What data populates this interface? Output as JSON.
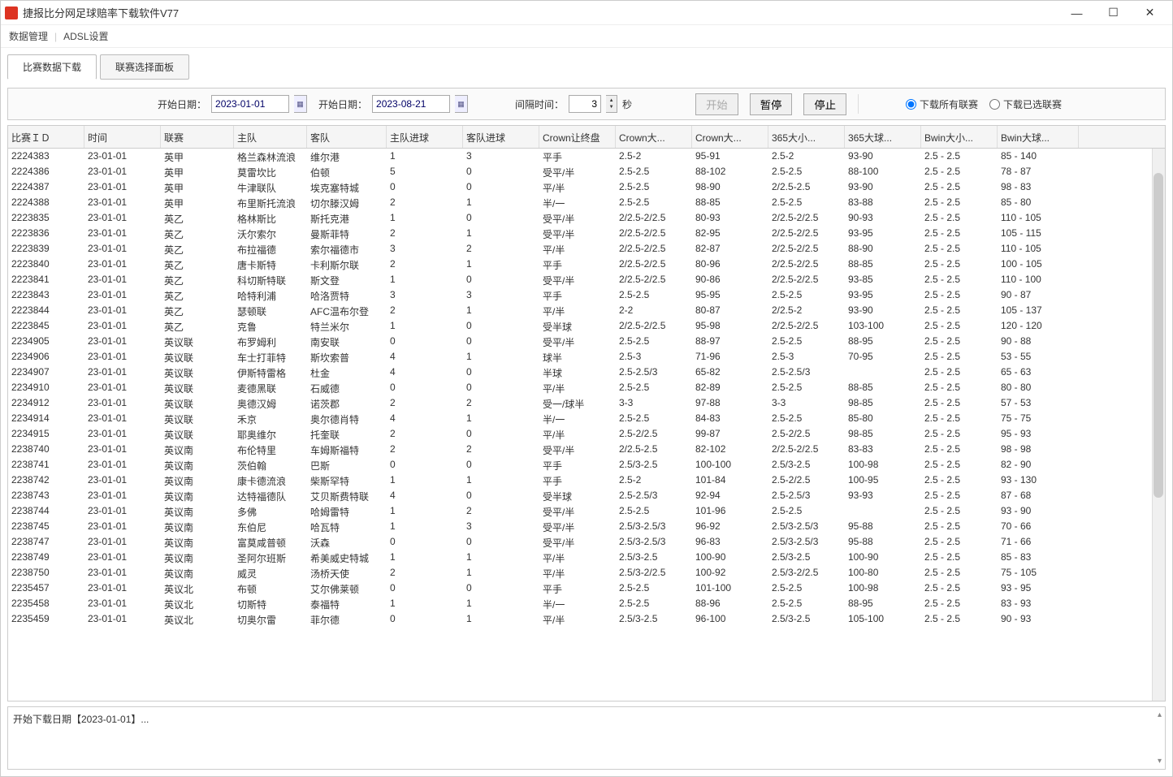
{
  "window": {
    "title": "捷报比分网足球赔率下载软件V77"
  },
  "menubar": {
    "data_mgmt": "数据管理",
    "adsl_settings": "ADSL设置"
  },
  "tabs": {
    "download": "比赛数据下载",
    "league_panel": "联赛选择面板"
  },
  "toolbar": {
    "start_date_label": "开始日期：",
    "start_date": "2023-01-01",
    "end_date_label": "开始日期：",
    "end_date": "2023-08-21",
    "interval_label": "间隔时间：",
    "interval_value": "3",
    "interval_unit": "秒",
    "btn_start": "开始",
    "btn_pause": "暂停",
    "btn_stop": "停止",
    "radio_all": "下载所有联赛",
    "radio_selected": "下载已选联赛"
  },
  "columns": [
    "比赛ＩＤ",
    "时间",
    "联赛",
    "主队",
    "客队",
    "主队进球",
    "客队进球",
    "Crown让终盘",
    "Crown大...",
    "Crown大...",
    "365大小...",
    "365大球...",
    "Bwin大小...",
    "Bwin大球..."
  ],
  "rows": [
    [
      "2224383",
      "23-01-01",
      "英甲",
      "格兰森林流浪",
      "维尔港",
      "1",
      "3",
      "平手",
      "2.5-2",
      "95-91",
      "2.5-2",
      "93-90",
      "2.5 - 2.5",
      "85 - 140"
    ],
    [
      "2224386",
      "23-01-01",
      "英甲",
      "莫雷坎比",
      "伯顿",
      "5",
      "0",
      "受平/半",
      "2.5-2.5",
      "88-102",
      "2.5-2.5",
      "88-100",
      "2.5 - 2.5",
      "78 - 87"
    ],
    [
      "2224387",
      "23-01-01",
      "英甲",
      "牛津联队",
      "埃克塞特城",
      "0",
      "0",
      "平/半",
      "2.5-2.5",
      "98-90",
      "2/2.5-2.5",
      "93-90",
      "2.5 - 2.5",
      "98 - 83"
    ],
    [
      "2224388",
      "23-01-01",
      "英甲",
      "布里斯托流浪",
      "切尔滕汉姆",
      "2",
      "1",
      "半/一",
      "2.5-2.5",
      "88-85",
      "2.5-2.5",
      "83-88",
      "2.5 - 2.5",
      "85 - 80"
    ],
    [
      "2223835",
      "23-01-01",
      "英乙",
      "格林斯比",
      "斯托克港",
      "1",
      "0",
      "受平/半",
      "2/2.5-2/2.5",
      "80-93",
      "2/2.5-2/2.5",
      "90-93",
      "2.5 - 2.5",
      "110 - 105"
    ],
    [
      "2223836",
      "23-01-01",
      "英乙",
      "沃尔索尔",
      "曼斯菲特",
      "2",
      "1",
      "受平/半",
      "2/2.5-2/2.5",
      "82-95",
      "2/2.5-2/2.5",
      "93-95",
      "2.5 - 2.5",
      "105 - 115"
    ],
    [
      "2223839",
      "23-01-01",
      "英乙",
      "布拉福德",
      "索尔福德市",
      "3",
      "2",
      "平/半",
      "2/2.5-2/2.5",
      "82-87",
      "2/2.5-2/2.5",
      "88-90",
      "2.5 - 2.5",
      "110 - 105"
    ],
    [
      "2223840",
      "23-01-01",
      "英乙",
      "唐卡斯特",
      "卡利斯尔联",
      "2",
      "1",
      "平手",
      "2/2.5-2/2.5",
      "80-96",
      "2/2.5-2/2.5",
      "88-85",
      "2.5 - 2.5",
      "100 - 105"
    ],
    [
      "2223841",
      "23-01-01",
      "英乙",
      "科切斯特联",
      "斯文登",
      "1",
      "0",
      "受平/半",
      "2/2.5-2/2.5",
      "90-86",
      "2/2.5-2/2.5",
      "93-85",
      "2.5 - 2.5",
      "110 - 100"
    ],
    [
      "2223843",
      "23-01-01",
      "英乙",
      "哈特利浦",
      "哈洛贾特",
      "3",
      "3",
      "平手",
      "2.5-2.5",
      "95-95",
      "2.5-2.5",
      "93-95",
      "2.5 - 2.5",
      "90 - 87"
    ],
    [
      "2223844",
      "23-01-01",
      "英乙",
      "瑟顿联",
      "AFC温布尔登",
      "2",
      "1",
      "平/半",
      "2-2",
      "80-87",
      "2/2.5-2",
      "93-90",
      "2.5 - 2.5",
      "105 - 137"
    ],
    [
      "2223845",
      "23-01-01",
      "英乙",
      "克鲁",
      "特兰米尔",
      "1",
      "0",
      "受半球",
      "2/2.5-2/2.5",
      "95-98",
      "2/2.5-2/2.5",
      "103-100",
      "2.5 - 2.5",
      "120 - 120"
    ],
    [
      "2234905",
      "23-01-01",
      "英议联",
      "布罗姆利",
      "南安联",
      "0",
      "0",
      "受平/半",
      "2.5-2.5",
      "88-97",
      "2.5-2.5",
      "88-95",
      "2.5 - 2.5",
      "90 - 88"
    ],
    [
      "2234906",
      "23-01-01",
      "英议联",
      "车士打菲特",
      "斯坎索普",
      "4",
      "1",
      "球半",
      "2.5-3",
      "71-96",
      "2.5-3",
      "70-95",
      "2.5 - 2.5",
      "53 - 55"
    ],
    [
      "2234907",
      "23-01-01",
      "英议联",
      "伊斯特雷格",
      "杜金",
      "4",
      "0",
      "半球",
      "2.5-2.5/3",
      "65-82",
      "2.5-2.5/3",
      "",
      "2.5 - 2.5",
      "65 - 63"
    ],
    [
      "2234910",
      "23-01-01",
      "英议联",
      "麦德黑联",
      "石威德",
      "0",
      "0",
      "平/半",
      "2.5-2.5",
      "82-89",
      "2.5-2.5",
      "88-85",
      "2.5 - 2.5",
      "80 - 80"
    ],
    [
      "2234912",
      "23-01-01",
      "英议联",
      "奥德汉姆",
      "诺茨郡",
      "2",
      "2",
      "受一/球半",
      "3-3",
      "97-88",
      "3-3",
      "98-85",
      "2.5 - 2.5",
      "57 - 53"
    ],
    [
      "2234914",
      "23-01-01",
      "英议联",
      "禾京",
      "奥尔德肖特",
      "4",
      "1",
      "半/一",
      "2.5-2.5",
      "84-83",
      "2.5-2.5",
      "85-80",
      "2.5 - 2.5",
      "75 - 75"
    ],
    [
      "2234915",
      "23-01-01",
      "英议联",
      "耶奥维尔",
      "托奎联",
      "2",
      "0",
      "平/半",
      "2.5-2/2.5",
      "99-87",
      "2.5-2/2.5",
      "98-85",
      "2.5 - 2.5",
      "95 - 93"
    ],
    [
      "2238740",
      "23-01-01",
      "英议南",
      "布伦特里",
      "车姆斯福特",
      "2",
      "2",
      "受平/半",
      "2/2.5-2.5",
      "82-102",
      "2/2.5-2/2.5",
      "83-83",
      "2.5 - 2.5",
      "98 - 98"
    ],
    [
      "2238741",
      "23-01-01",
      "英议南",
      "茨伯翰",
      "巴斯",
      "0",
      "0",
      "平手",
      "2.5/3-2.5",
      "100-100",
      "2.5/3-2.5",
      "100-98",
      "2.5 - 2.5",
      "82 - 90"
    ],
    [
      "2238742",
      "23-01-01",
      "英议南",
      "康卡德流浪",
      "柴斯罕特",
      "1",
      "1",
      "平手",
      "2.5-2",
      "101-84",
      "2.5-2/2.5",
      "100-95",
      "2.5 - 2.5",
      "93 - 130"
    ],
    [
      "2238743",
      "23-01-01",
      "英议南",
      "达特福德队",
      "艾贝斯费特联",
      "4",
      "0",
      "受半球",
      "2.5-2.5/3",
      "92-94",
      "2.5-2.5/3",
      "93-93",
      "2.5 - 2.5",
      "87 - 68"
    ],
    [
      "2238744",
      "23-01-01",
      "英议南",
      "多佛",
      "哈姆雷特",
      "1",
      "2",
      "受平/半",
      "2.5-2.5",
      "101-96",
      "2.5-2.5",
      "",
      "2.5 - 2.5",
      "93 - 90"
    ],
    [
      "2238745",
      "23-01-01",
      "英议南",
      "东伯尼",
      "哈瓦特",
      "1",
      "3",
      "受平/半",
      "2.5/3-2.5/3",
      "96-92",
      "2.5/3-2.5/3",
      "95-88",
      "2.5 - 2.5",
      "70 - 66"
    ],
    [
      "2238747",
      "23-01-01",
      "英议南",
      "富莫咸普顿",
      "沃森",
      "0",
      "0",
      "受平/半",
      "2.5/3-2.5/3",
      "96-83",
      "2.5/3-2.5/3",
      "95-88",
      "2.5 - 2.5",
      "71 - 66"
    ],
    [
      "2238749",
      "23-01-01",
      "英议南",
      "圣阿尔班斯",
      "希美威史特城",
      "1",
      "1",
      "平/半",
      "2.5/3-2.5",
      "100-90",
      "2.5/3-2.5",
      "100-90",
      "2.5 - 2.5",
      "85 - 83"
    ],
    [
      "2238750",
      "23-01-01",
      "英议南",
      "威灵",
      "汤桥天使",
      "2",
      "1",
      "平/半",
      "2.5/3-2/2.5",
      "100-92",
      "2.5/3-2/2.5",
      "100-80",
      "2.5 - 2.5",
      "75 - 105"
    ],
    [
      "2235457",
      "23-01-01",
      "英议北",
      "布顿",
      "艾尔佛莱顿",
      "0",
      "0",
      "平手",
      "2.5-2.5",
      "101-100",
      "2.5-2.5",
      "100-98",
      "2.5 - 2.5",
      "93 - 95"
    ],
    [
      "2235458",
      "23-01-01",
      "英议北",
      "切斯特",
      "泰福特",
      "1",
      "1",
      "半/一",
      "2.5-2.5",
      "88-96",
      "2.5-2.5",
      "88-95",
      "2.5 - 2.5",
      "83 - 93"
    ],
    [
      "2235459",
      "23-01-01",
      "英议北",
      "切奥尔雷",
      "菲尔德",
      "0",
      "1",
      "平/半",
      "2.5/3-2.5",
      "96-100",
      "2.5/3-2.5",
      "105-100",
      "2.5 - 2.5",
      "90 - 93"
    ]
  ],
  "log": {
    "text": "开始下载日期【2023-01-01】..."
  }
}
